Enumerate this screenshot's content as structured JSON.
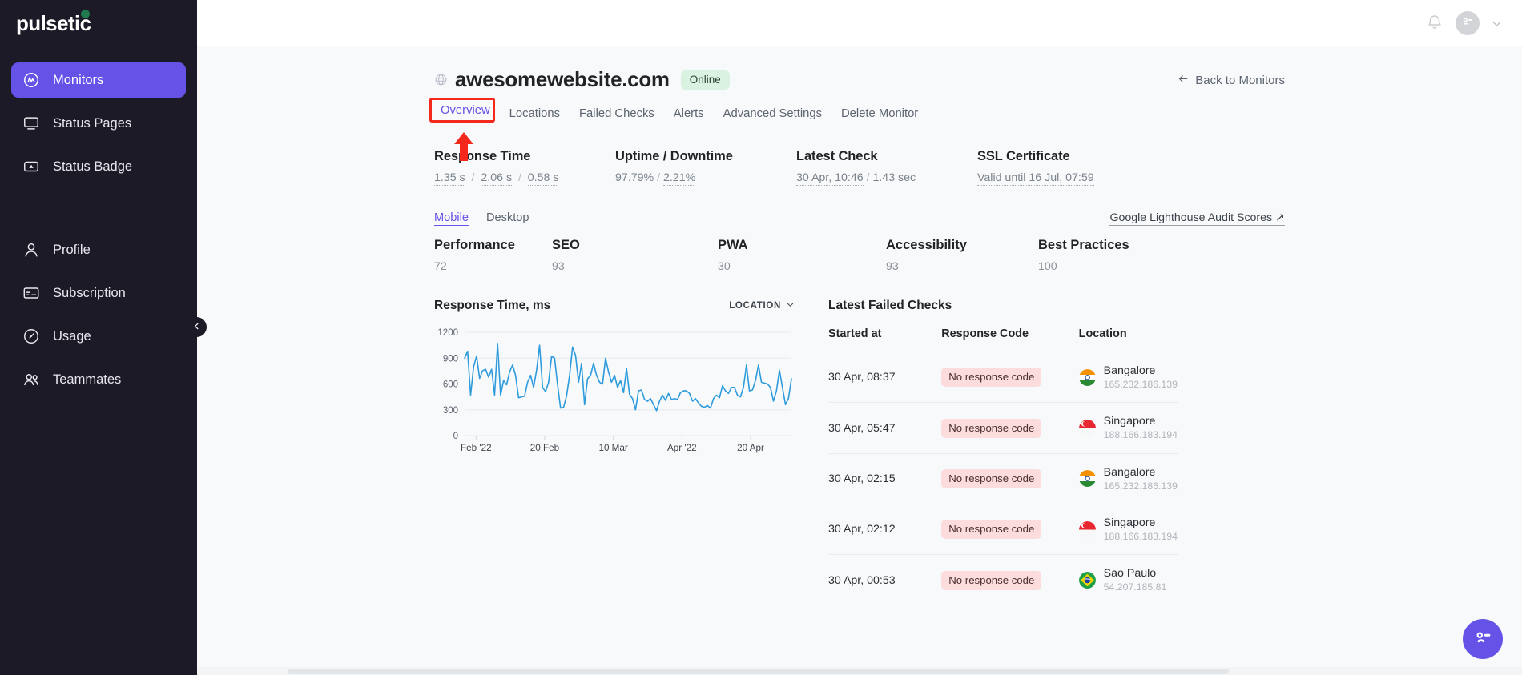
{
  "brand": {
    "name": "pulsetic"
  },
  "sidebar": {
    "items": [
      {
        "label": "Monitors",
        "icon": "monitors-icon",
        "active": true
      },
      {
        "label": "Status Pages",
        "icon": "status-pages-icon",
        "active": false
      },
      {
        "label": "Status Badge",
        "icon": "status-badge-icon",
        "active": false
      },
      {
        "label": "Profile",
        "icon": "profile-icon",
        "active": false
      },
      {
        "label": "Subscription",
        "icon": "subscription-icon",
        "active": false
      },
      {
        "label": "Usage",
        "icon": "usage-icon",
        "active": false
      },
      {
        "label": "Teammates",
        "icon": "teammates-icon",
        "active": false
      }
    ],
    "collapse_icon": "chevron-left-icon"
  },
  "topbar": {
    "bell_icon": "notification-bell-icon",
    "avatar_icon": "user-avatar-icon",
    "chevron_icon": "chevron-down-icon"
  },
  "header": {
    "globe_icon": "globe-icon",
    "title": "awesomewebsite.com",
    "status": "Online",
    "back_link": "Back to Monitors",
    "back_icon": "arrow-left-icon"
  },
  "tabs": [
    {
      "label": "Overview",
      "active": true,
      "highlighted": true
    },
    {
      "label": "Locations",
      "active": false,
      "highlighted": false
    },
    {
      "label": "Failed Checks",
      "active": false,
      "highlighted": false
    },
    {
      "label": "Alerts",
      "active": false,
      "highlighted": false
    },
    {
      "label": "Advanced Settings",
      "active": false,
      "highlighted": false
    },
    {
      "label": "Delete Monitor",
      "active": false,
      "highlighted": false
    }
  ],
  "annotation": {
    "box_color": "#f5291b",
    "arrow_color": "#f5291b",
    "target": "Overview"
  },
  "stats": {
    "response_time": {
      "heading": "Response Time",
      "avg": "1.35 s",
      "max": "2.06 s",
      "min": "0.58 s"
    },
    "uptime": {
      "heading": "Uptime / Downtime",
      "up": "97.79%",
      "down": "2.21%"
    },
    "latest_check": {
      "heading": "Latest Check",
      "time": "30 Apr, 10:46",
      "duration": "1.43 sec"
    },
    "ssl": {
      "heading": "SSL Certificate",
      "value": "Valid until 16 Jul, 07:59"
    }
  },
  "lighthouse": {
    "toggle": [
      {
        "label": "Mobile",
        "active": true
      },
      {
        "label": "Desktop",
        "active": false
      }
    ],
    "link": "Google Lighthouse Audit Scores",
    "link_icon": "external-link-icon",
    "scores": [
      {
        "label": "Performance",
        "value": "72"
      },
      {
        "label": "SEO",
        "value": "93"
      },
      {
        "label": "PWA",
        "value": "30"
      },
      {
        "label": "Accessibility",
        "value": "93"
      },
      {
        "label": "Best Practices",
        "value": "100"
      }
    ]
  },
  "chart_data": {
    "type": "line",
    "title": "Response Time, ms",
    "xlabel": "",
    "ylabel": "ms",
    "ylim": [
      0,
      1200
    ],
    "yticks": [
      0,
      300,
      600,
      900,
      1200
    ],
    "xticks": [
      "Feb '22",
      "20 Feb",
      "10 Mar",
      "Apr '22",
      "20 Apr"
    ],
    "xtick_positions": [
      0.035,
      0.245,
      0.455,
      0.665,
      0.875
    ],
    "grid": true,
    "legend": "none",
    "line_color": "#2e9bdd",
    "series": [
      {
        "name": "Response Time",
        "values": [
          900,
          980,
          470,
          800,
          925,
          665,
          755,
          770,
          680,
          770,
          470,
          1070,
          470,
          640,
          590,
          740,
          820,
          700,
          440,
          450,
          460,
          620,
          700,
          560,
          760,
          1050,
          560,
          510,
          620,
          920,
          900,
          590,
          320,
          330,
          460,
          700,
          1030,
          930,
          620,
          840,
          360,
          660,
          700,
          840,
          700,
          620,
          600,
          900,
          740,
          620,
          700,
          560,
          640,
          500,
          780,
          480,
          430,
          300,
          520,
          530,
          420,
          400,
          430,
          360,
          290,
          400,
          470,
          410,
          490,
          420,
          430,
          420,
          500,
          520,
          520,
          490,
          400,
          430,
          380,
          340,
          330,
          350,
          320,
          430,
          470,
          440,
          580,
          520,
          490,
          560,
          560,
          470,
          450,
          560,
          820,
          520,
          530,
          640,
          820,
          620,
          610,
          600,
          560,
          400,
          520,
          760,
          560,
          360,
          430,
          660
        ]
      }
    ]
  },
  "chart_panel": {
    "location_select": "LOCATION",
    "chevron_icon": "chevron-down-icon"
  },
  "failed_checks": {
    "title": "Latest Failed Checks",
    "columns": [
      "Started at",
      "Response Code",
      "Location"
    ],
    "rows": [
      {
        "started_at": "30 Apr, 08:37",
        "response_code": "No response code",
        "location": "Bangalore",
        "ip": "165.232.186.139",
        "flag": "india-flag-icon"
      },
      {
        "started_at": "30 Apr, 05:47",
        "response_code": "No response code",
        "location": "Singapore",
        "ip": "188.166.183.194",
        "flag": "singapore-flag-icon"
      },
      {
        "started_at": "30 Apr, 02:15",
        "response_code": "No response code",
        "location": "Bangalore",
        "ip": "165.232.186.139",
        "flag": "india-flag-icon"
      },
      {
        "started_at": "30 Apr, 02:12",
        "response_code": "No response code",
        "location": "Singapore",
        "ip": "188.166.183.194",
        "flag": "singapore-flag-icon"
      },
      {
        "started_at": "30 Apr, 00:53",
        "response_code": "No response code",
        "location": "Sao Paulo",
        "ip": "54.207.185.81",
        "flag": "brazil-flag-icon"
      }
    ]
  },
  "chat": {
    "icon": "chat-avatar-icon",
    "color": "#6553e8"
  },
  "colors": {
    "accent": "#6553e8",
    "sidebar_bg": "#1b1a26",
    "page_bg": "#f7f9fa",
    "online_badge_bg": "#d9f2e2",
    "error_badge_bg": "#fcdcdc",
    "chart_line": "#2e9bdd",
    "annotation": "#f5291b"
  }
}
